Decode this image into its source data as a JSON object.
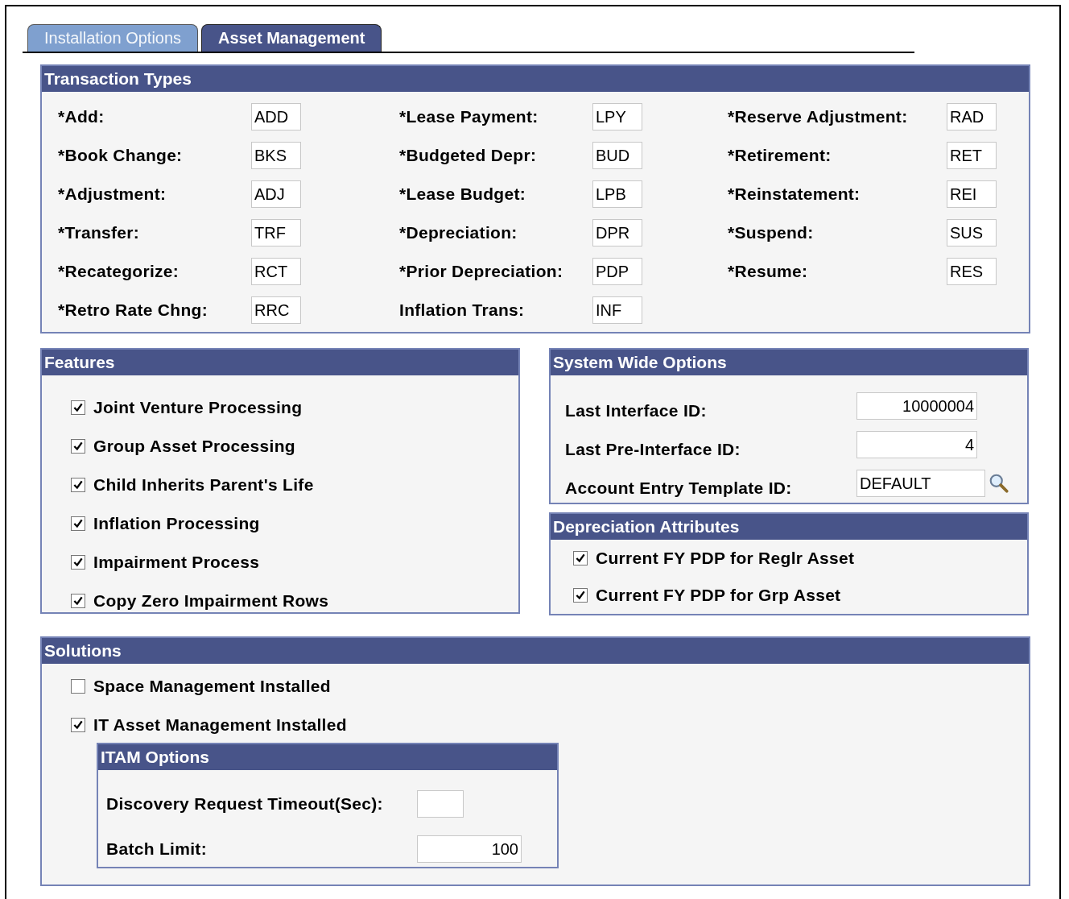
{
  "tabs": [
    {
      "label": "Installation Options",
      "selected": false
    },
    {
      "label": "Asset Management",
      "selected": true
    }
  ],
  "transaction_types": {
    "title": "Transaction Types",
    "columns": [
      [
        {
          "label": "*Add:",
          "value": "ADD"
        },
        {
          "label": "*Book Change:",
          "value": "BKS"
        },
        {
          "label": "*Adjustment:",
          "value": "ADJ"
        },
        {
          "label": "*Transfer:",
          "value": "TRF"
        },
        {
          "label": "*Recategorize:",
          "value": "RCT"
        },
        {
          "label": "*Retro Rate Chng:",
          "value": "RRC"
        }
      ],
      [
        {
          "label": "*Lease Payment:",
          "value": "LPY"
        },
        {
          "label": "*Budgeted Depr:",
          "value": "BUD"
        },
        {
          "label": "*Lease Budget:",
          "value": "LPB"
        },
        {
          "label": "*Depreciation:",
          "value": "DPR"
        },
        {
          "label": "*Prior Depreciation:",
          "value": "PDP"
        },
        {
          "label": "Inflation Trans:",
          "value": "INF"
        }
      ],
      [
        {
          "label": "*Reserve Adjustment:",
          "value": "RAD"
        },
        {
          "label": "*Retirement:",
          "value": "RET"
        },
        {
          "label": "*Reinstatement:",
          "value": "REI"
        },
        {
          "label": "*Suspend:",
          "value": "SUS"
        },
        {
          "label": "*Resume:",
          "value": "RES"
        }
      ]
    ]
  },
  "features": {
    "title": "Features",
    "items": [
      {
        "label": "Joint Venture Processing",
        "checked": true
      },
      {
        "label": "Group Asset Processing",
        "checked": true
      },
      {
        "label": "Child Inherits Parent's Life",
        "checked": true
      },
      {
        "label": "Inflation Processing",
        "checked": true
      },
      {
        "label": "Impairment Process",
        "checked": true
      },
      {
        "label": "Copy Zero Impairment Rows",
        "checked": true
      }
    ]
  },
  "system_wide_options": {
    "title": "System Wide Options",
    "fields": [
      {
        "label": "Last Interface ID:",
        "value": "10000004",
        "kind": "number"
      },
      {
        "label": "Last Pre-Interface ID:",
        "value": "4",
        "kind": "number"
      },
      {
        "label": "Account Entry Template ID:",
        "value": "DEFAULT",
        "kind": "lookup"
      }
    ]
  },
  "depreciation_attributes": {
    "title": "Depreciation Attributes",
    "items": [
      {
        "label": "Current FY PDP for Reglr Asset",
        "checked": true
      },
      {
        "label": "Current FY PDP for Grp Asset",
        "checked": true
      }
    ]
  },
  "solutions": {
    "title": "Solutions",
    "items": [
      {
        "label": "Space Management Installed",
        "checked": false
      },
      {
        "label": "IT Asset Management Installed",
        "checked": true
      }
    ],
    "itam_options": {
      "title": "ITAM Options",
      "fields": [
        {
          "label": "Discovery Request Timeout(Sec):",
          "kind": "short"
        },
        {
          "label": "Batch Limit:",
          "value": "100",
          "kind": "number"
        }
      ]
    }
  }
}
